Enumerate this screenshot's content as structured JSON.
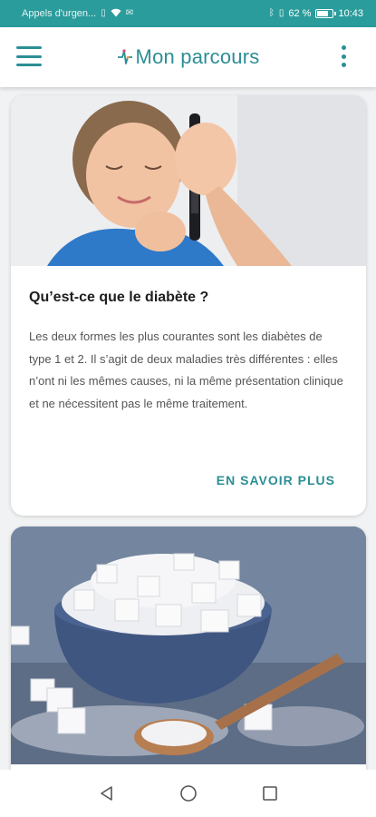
{
  "status_bar": {
    "carrier": "Appels d'urgen...",
    "battery": "62 %",
    "battery_level": 0.62,
    "time": "10:43",
    "icons": [
      "sim-icon",
      "wifi-icon",
      "message-icon",
      "bluetooth-icon",
      "vibrate-icon",
      "battery-icon"
    ]
  },
  "app_bar": {
    "title": "Mon parcours",
    "menu_icon": "hamburger-menu-icon",
    "more_icon": "more-vertical-icon",
    "accent_color": "#2b8f95"
  },
  "cards": [
    {
      "title": "Qu’est-ce que le diabète ?",
      "body": "Les deux formes les plus courantes sont les diabètes de type 1 et 2. Il s’agit de deux maladies très différentes : elles n’ont ni les mêmes causes, ni la même présentation clinique et ne nécessitent pas le même traitement.",
      "action": "EN SAVOIR PLUS",
      "image": "girl-glucose-test-photo"
    },
    {
      "image": "sugar-cubes-bowl-photo"
    }
  ],
  "nav_bar": {
    "back_icon": "back-triangle-icon",
    "home_icon": "home-circle-icon",
    "recents_icon": "recents-square-icon"
  }
}
